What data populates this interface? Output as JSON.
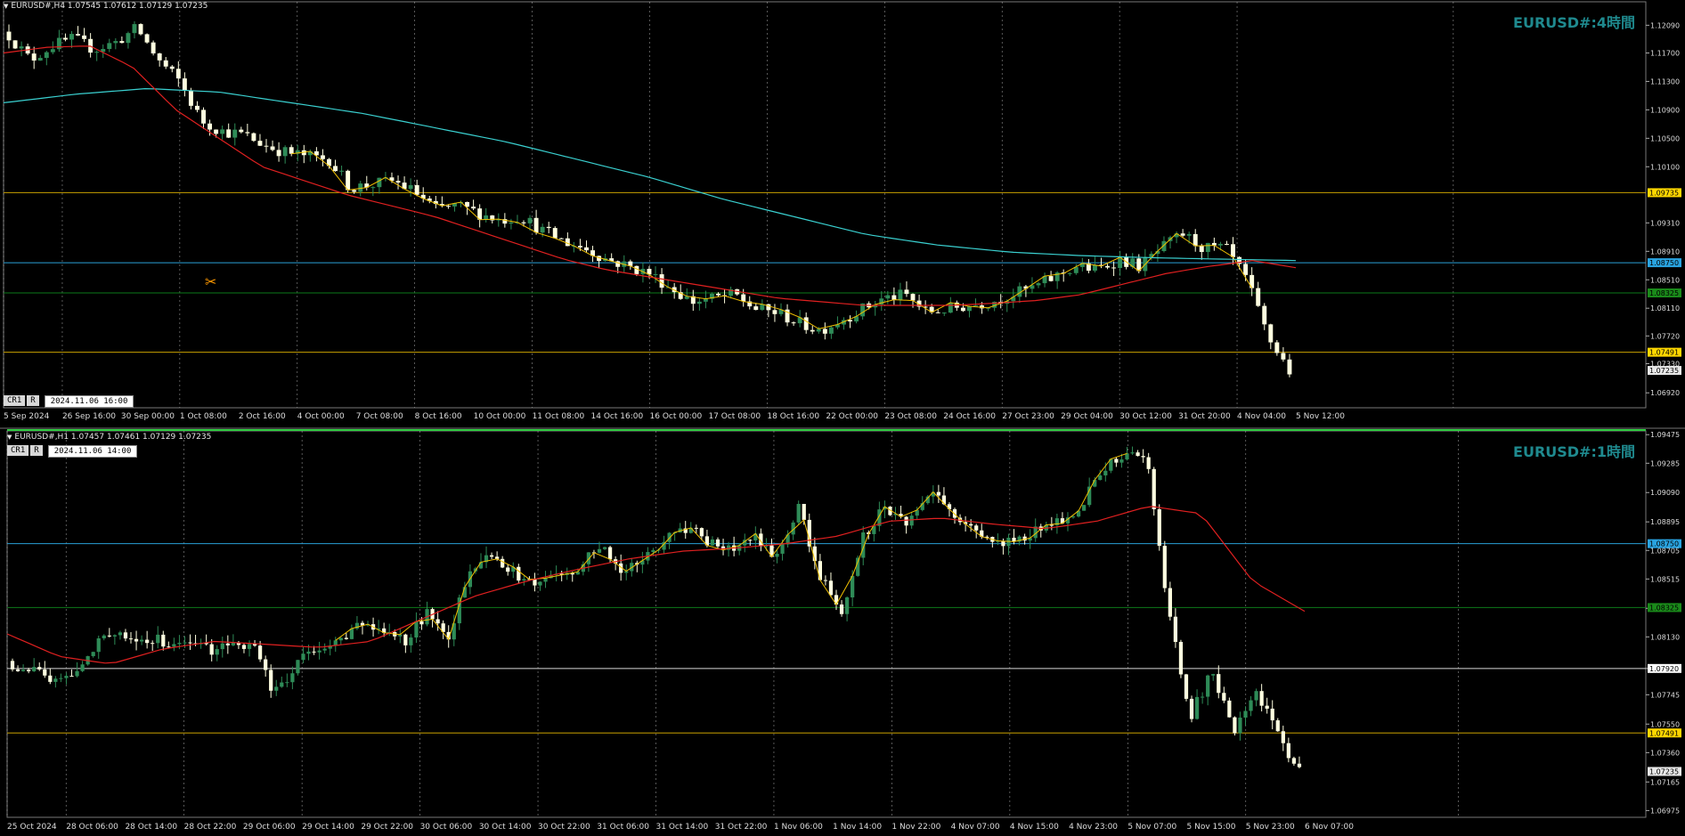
{
  "top": {
    "info": "EURUSD#,H4  1.07545 1.07612 1.07129 1.07235",
    "watermark": "EURUSD#:4時間",
    "cr_labels": [
      "CR1",
      "R"
    ],
    "cursor_time": "2024.11.06 16:00",
    "price_axis": [
      "1.12090",
      "1.11700",
      "1.11300",
      "1.10900",
      "1.10500",
      "1.10100",
      "1.09310",
      "1.08910",
      "1.08510",
      "1.08110",
      "1.07720",
      "1.07330",
      "1.06920"
    ],
    "price_range": [
      1.0671,
      1.1242
    ],
    "time_labels": [
      "5 Sep 2024",
      "26 Sep 16:00",
      "30 Sep 00:00",
      "1 Oct 08:00",
      "2 Oct 16:00",
      "4 Oct 00:00",
      "7 Oct 08:00",
      "8 Oct 16:00",
      "10 Oct 00:00",
      "11 Oct 08:00",
      "14 Oct 16:00",
      "16 Oct 00:00",
      "17 Oct 08:00",
      "18 Oct 16:00",
      "22 Oct 00:00",
      "23 Oct 08:00",
      "24 Oct 16:00",
      "27 Oct 23:00",
      "29 Oct 04:00",
      "30 Oct 12:00",
      "31 Oct 20:00",
      "4 Nov 04:00",
      "5 Nov 12:00"
    ],
    "hlines": [
      {
        "price": 1.09735,
        "label": "1.09735",
        "color": "#c8a000",
        "tag_bg": "#ffd700",
        "tag_fg": "#000"
      },
      {
        "price": 1.0875,
        "label": "1.08750",
        "color": "#2a9fd6",
        "tag_bg": "#29a3e0",
        "tag_fg": "#000"
      },
      {
        "price": 1.08325,
        "label": "1.08325",
        "color": "#0d7a1a",
        "tag_bg": "#1a8a1a",
        "tag_fg": "#000"
      },
      {
        "price": 1.07491,
        "label": "1.07491",
        "color": "#c8a000",
        "tag_bg": "#ffd700",
        "tag_fg": "#000"
      }
    ],
    "current_price": {
      "price": 1.07235,
      "label": "1.07235"
    },
    "colors": {
      "ma_fast": "#e02020",
      "ma_slow": "#3ad0d0",
      "zigzag": "#f0c000",
      "bull": "#2e8b57",
      "bear": "#ffffe0",
      "grid": "#d0d0d0"
    }
  },
  "bottom": {
    "info": "EURUSD#,H1  1.07457 1.07461 1.07129 1.07235",
    "watermark": "EURUSD#:1時間",
    "cr_labels": [
      "CR1",
      "R"
    ],
    "cursor_time": "2024.11.06 14:00",
    "price_axis": [
      "1.09475",
      "1.09285",
      "1.09090",
      "1.08895",
      "1.08705",
      "1.08515",
      "1.08320",
      "1.08130",
      "1.07920",
      "1.07745",
      "1.07550",
      "1.07360",
      "1.07165",
      "1.06975"
    ],
    "price_range": [
      1.0693,
      1.095
    ],
    "time_labels": [
      "25 Oct 2024",
      "28 Oct 06:00",
      "28 Oct 14:00",
      "28 Oct 22:00",
      "29 Oct 06:00",
      "29 Oct 14:00",
      "29 Oct 22:00",
      "30 Oct 06:00",
      "30 Oct 14:00",
      "30 Oct 22:00",
      "31 Oct 06:00",
      "31 Oct 14:00",
      "31 Oct 22:00",
      "1 Nov 06:00",
      "1 Nov 14:00",
      "1 Nov 22:00",
      "4 Nov 07:00",
      "4 Nov 15:00",
      "4 Nov 23:00",
      "5 Nov 07:00",
      "5 Nov 15:00",
      "5 Nov 23:00",
      "6 Nov 07:00"
    ],
    "hlines": [
      {
        "price": 1.0875,
        "label": "1.08750",
        "color": "#2a9fd6",
        "tag_bg": "#29a3e0",
        "tag_fg": "#000"
      },
      {
        "price": 1.08325,
        "label": "1.08325",
        "color": "#0d7a1a",
        "tag_bg": "#1a8a1a",
        "tag_fg": "#000"
      },
      {
        "price": 1.0792,
        "label": "1.07920",
        "color": "#d8d8d8",
        "tag_bg": "#ffffff",
        "tag_fg": "#000"
      },
      {
        "price": 1.07491,
        "label": "1.07491",
        "color": "#c8a000",
        "tag_bg": "#ffd700",
        "tag_fg": "#000"
      }
    ],
    "current_price": {
      "price": 1.07235,
      "label": "1.07235"
    },
    "colors": {
      "ma_fast": "#e02020",
      "zigzag": "#f0c000",
      "bull": "#2e8b57",
      "bear": "#ffffe0",
      "grid": "#d0d0d0",
      "top_bar": "#2ecc40"
    }
  },
  "chart_data": [
    {
      "type": "candlestick",
      "title": "EURUSD#,H4",
      "ylim": [
        1.0671,
        1.1242
      ],
      "series": [
        {
          "name": "close_path",
          "values": [
            1.1195,
            1.116,
            1.118,
            1.119,
            1.1175,
            1.1185,
            1.1205,
            1.116,
            1.113,
            1.1075,
            1.106,
            1.1055,
            1.104,
            1.103,
            1.1025,
            1.102,
            1.098,
            1.0985,
            1.099,
            1.0975,
            1.095,
            1.0955,
            1.0945,
            1.0935,
            1.094,
            1.092,
            1.0905,
            1.0895,
            1.088,
            1.087,
            1.086,
            1.084,
            1.082,
            1.0825,
            1.083,
            1.081,
            1.0805,
            1.079,
            1.078,
            1.0795,
            1.081,
            1.0825,
            1.083,
            1.0805,
            1.081,
            1.0815,
            1.082,
            1.083,
            1.084,
            1.0855,
            1.087,
            1.0865,
            1.088,
            1.087,
            1.0895,
            1.0915,
            1.0895,
            1.0895,
            1.085,
            1.077,
            1.0723
          ]
        },
        {
          "name": "ma_fast",
          "values": [
            1.117,
            1.1178,
            1.118,
            1.115,
            1.109,
            1.105,
            1.101,
            1.099,
            1.097,
            1.0955,
            1.094,
            1.092,
            1.09,
            1.088,
            1.0865,
            1.0855,
            1.0845,
            1.0835,
            1.0825,
            1.082,
            1.0815,
            1.0815,
            1.0815,
            1.0818,
            1.0822,
            1.083,
            1.0845,
            1.086,
            1.087,
            1.0878,
            1.0868
          ]
        },
        {
          "name": "ma_slow",
          "values": [
            1.11,
            1.1112,
            1.112,
            1.1115,
            1.11,
            1.1085,
            1.1065,
            1.1045,
            1.102,
            1.0995,
            1.0965,
            1.094,
            1.0915,
            1.09,
            1.089,
            1.0885,
            1.0882,
            1.088,
            1.0878
          ]
        }
      ]
    },
    {
      "type": "candlestick",
      "title": "EURUSD#,H1",
      "ylim": [
        1.0693,
        1.095
      ],
      "series": [
        {
          "name": "close_path",
          "values": [
            1.0792,
            1.079,
            1.0784,
            1.079,
            1.081,
            1.0815,
            1.0812,
            1.081,
            1.0808,
            1.0805,
            1.0806,
            1.081,
            1.0775,
            1.0795,
            1.0805,
            1.0812,
            1.082,
            1.0815,
            1.081,
            1.083,
            1.0815,
            1.086,
            1.087,
            1.0855,
            1.085,
            1.0855,
            1.086,
            1.0875,
            1.0855,
            1.0865,
            1.088,
            1.0885,
            1.0875,
            1.087,
            1.088,
            1.0865,
            1.09,
            1.0855,
            1.083,
            1.088,
            1.09,
            1.089,
            1.091,
            1.0895,
            1.0885,
            1.0875,
            1.0878,
            1.0885,
            1.089,
            1.09,
            1.0925,
            1.0935,
            1.093,
            1.083,
            1.076,
            1.079,
            1.075,
            1.0775,
            1.075,
            1.0723
          ]
        },
        {
          "name": "ma_fast",
          "values": [
            1.0815,
            1.08,
            1.0795,
            1.0805,
            1.081,
            1.0808,
            1.0806,
            1.081,
            1.0825,
            1.084,
            1.085,
            1.0858,
            1.0865,
            1.087,
            1.0872,
            1.0875,
            1.088,
            1.089,
            1.0892,
            1.0888,
            1.0885,
            1.089,
            1.09,
            1.0895,
            1.085,
            1.083
          ]
        }
      ]
    }
  ]
}
